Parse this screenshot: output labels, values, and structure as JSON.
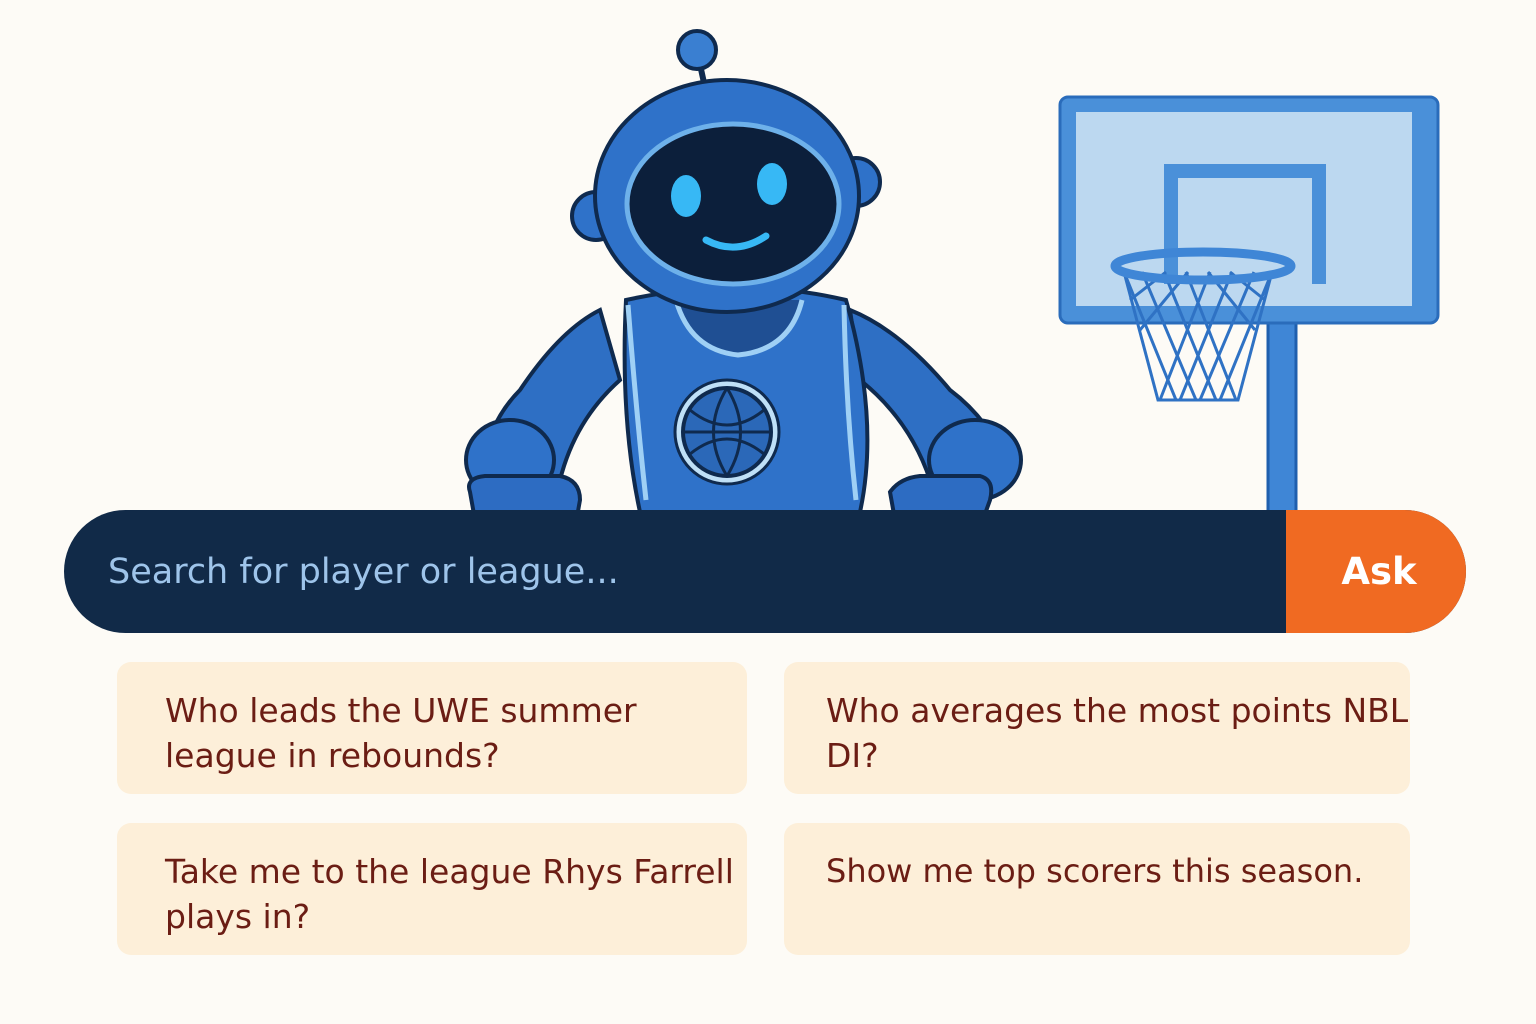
{
  "search": {
    "placeholder": "Search for player or league...",
    "button_label": "Ask"
  },
  "suggestions": [
    "Who leads the UWE summer league in rebounds?",
    "Who averages the most points NBL DI?",
    "Take me to the league Rhys Farrell plays in?",
    "Show me top scorers this season."
  ],
  "icons": {
    "mascot": "robot-mascot-icon",
    "hoop": "basketball-hoop-icon",
    "ball": "basketball-icon"
  },
  "colors": {
    "background": "#fdfbf6",
    "search_bar": "#112a48",
    "search_placeholder": "#9ec4ea",
    "ask_button": "#f06a22",
    "suggestion_bg": "#fdefd9",
    "suggestion_text": "#6b1d14",
    "robot_blue": "#2e6fc4",
    "hoop_blue": "#4a90d9"
  }
}
